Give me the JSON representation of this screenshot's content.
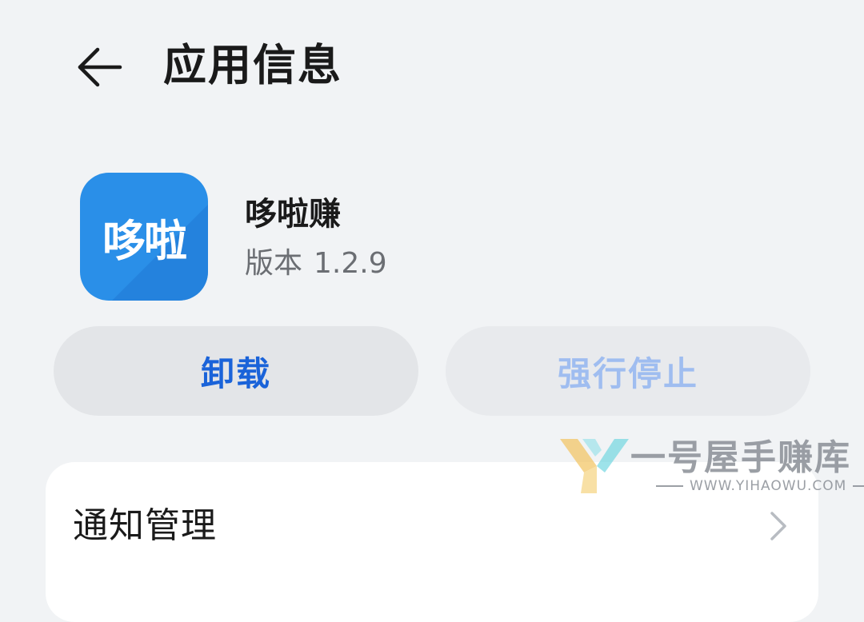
{
  "header": {
    "back_icon": "arrow-left-icon",
    "title": "应用信息"
  },
  "app": {
    "icon_text": "哆啦",
    "icon_color": "#2a8fe8",
    "name": "哆啦赚",
    "version_label": "版本",
    "version_value": "1.2.9"
  },
  "actions": {
    "uninstall_label": "卸载",
    "force_stop_label": "强行停止",
    "uninstall_color": "#1a63d9",
    "force_stop_color": "#9fbdf0"
  },
  "settings": {
    "items": [
      {
        "label": "通知管理",
        "icon": "chevron-right-icon"
      }
    ]
  },
  "watermark": {
    "name": "一号屋手赚库",
    "url": "WWW.YIHAOWU.COM"
  }
}
